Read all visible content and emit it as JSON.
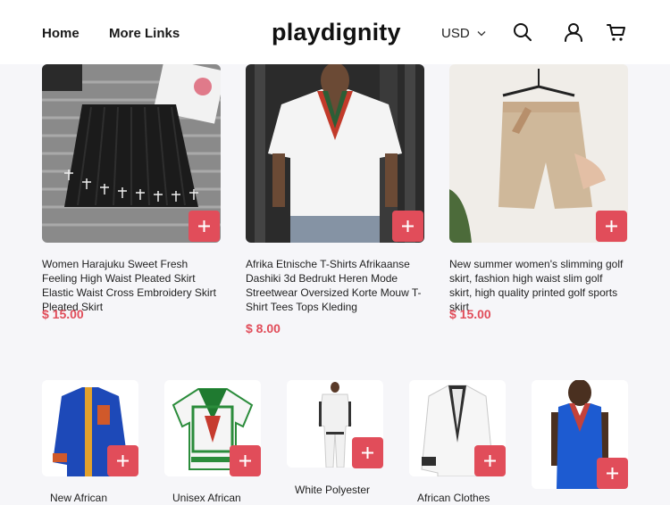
{
  "header": {
    "nav": [
      {
        "label": "Home"
      },
      {
        "label": "More Links"
      }
    ],
    "logo": "playdignity",
    "currency": "USD",
    "icons": [
      "search-icon",
      "user-icon",
      "cart-icon"
    ]
  },
  "colors": {
    "accent": "#e14d5a",
    "background": "#f6f6f9",
    "header_bg": "#ffffff"
  },
  "products_row1": [
    {
      "title": "Women Harajuku Sweet Fresh Feeling High Waist Pleated Skirt Elastic Waist Cross Embroidery Skirt Pleated Skirt",
      "price": "$ 15.00"
    },
    {
      "title": "Afrika Etnische T-Shirts Afrikaanse Dashiki 3d Bedrukt Heren Mode Streetwear Oversized Korte Mouw T-Shirt Tees Tops Kleding",
      "price": "$ 8.00"
    },
    {
      "title": "New summer women's slimming golf skirt, fashion high waist slim golf skirt, high quality printed golf sports skirt",
      "price": "$ 15.00"
    }
  ],
  "products_row2": [
    {
      "title": "New African"
    },
    {
      "title": "Unisex African"
    },
    {
      "title": "White Polyester"
    },
    {
      "title": "African Clothes"
    },
    {
      "title": ""
    }
  ]
}
